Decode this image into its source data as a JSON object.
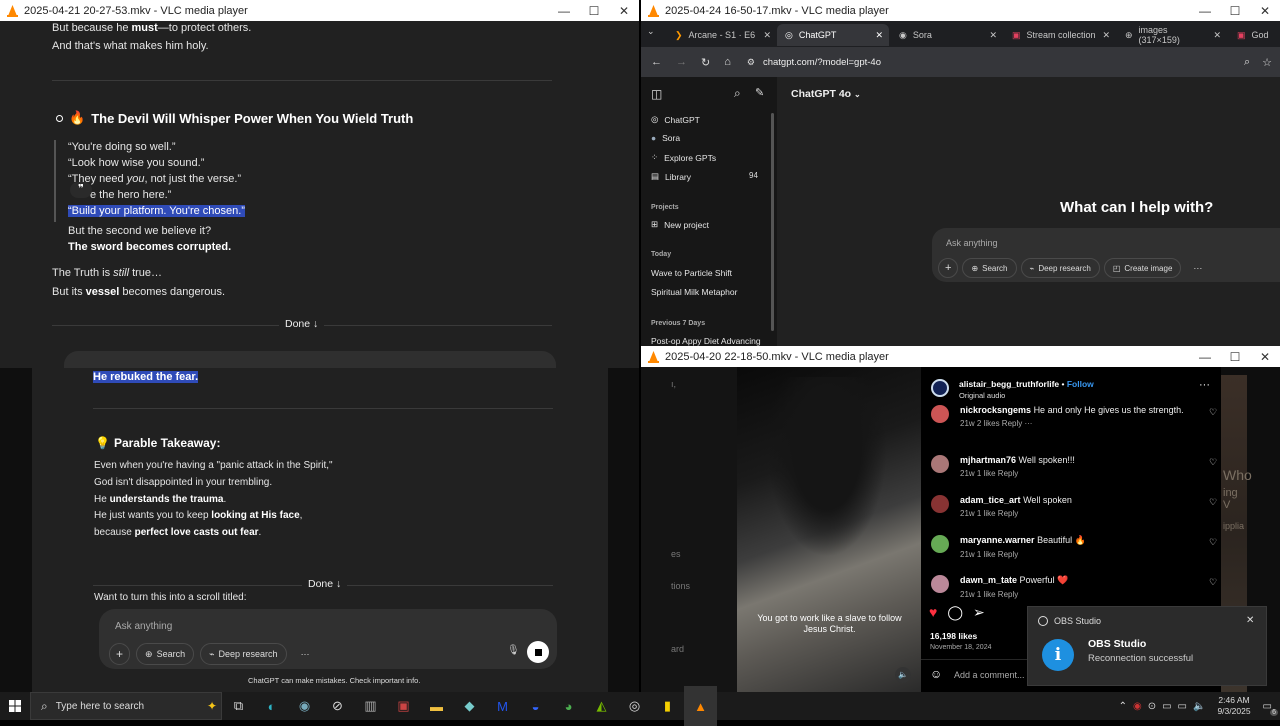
{
  "vlc1": {
    "title": "2025-04-21 20-27-53.mkv - VLC media player"
  },
  "vlc2": {
    "title": "2025-04-24 16-50-17.mkv - VLC media player"
  },
  "vlc3": {
    "title": "2025-04-20 22-18-50.mkv - VLC media player"
  },
  "chat1": {
    "line1a": "But because he ",
    "line1b": "must",
    "line1c": "—to protect others.",
    "line2": "And that's what makes him holy.",
    "heading": "The Devil Will Whisper Power When You Wield Truth",
    "q1": "“You're doing so well.”",
    "q2": "“Look how wise you sound.”",
    "q3a": "“They need ",
    "q3b": "you",
    "q3c": ", not just the verse.”",
    "q4": "e the hero here.”",
    "q5": "“Build your platform. You're chosen.”",
    "p1": "But the second we believe it?",
    "p2": "The sword becomes corrupted.",
    "t1a": "The Truth is ",
    "t1b": "still",
    "t1c": " true…",
    "t2a": "But its ",
    "t2b": "vessel",
    "t2c": " becomes dangerous.",
    "done": "Done",
    "ask": "Ask anything"
  },
  "chat2": {
    "hl": "He rebuked the fear.",
    "heading": "Parable Takeaway:",
    "l1": "Even when you're having a \"panic attack in the Spirit,\"",
    "l2": "God isn't disappointed in your trembling.",
    "l3a": "He ",
    "l3b": "understands the trauma",
    "l4a": "He just wants you to keep ",
    "l4b": "looking at His face",
    "l5a": "because ",
    "l5b": "perfect love casts out fear",
    "done": "Done",
    "scroll": "Want to turn this into a scroll titled:",
    "ask": "Ask anything",
    "search": "Search",
    "deep": "Deep research",
    "disclaimer": "ChatGPT can make mistakes. Check important info."
  },
  "browser": {
    "tabs": [
      "Arcane - S1 · E6",
      "ChatGPT",
      "Sora",
      "Stream collection",
      "images (317×159)",
      "God"
    ],
    "url": "chatgpt.com/?model=gpt-4o",
    "model": "ChatGPT 4o",
    "side": [
      "ChatGPT",
      "Sora",
      "Explore GPTs",
      "Library"
    ],
    "library_count": "94",
    "projects": "Projects",
    "new_project": "New project",
    "today": "Today",
    "today_items": [
      "Wave to Particle Shift",
      "Spiritual Milk Metaphor"
    ],
    "prev": "Previous 7 Days",
    "prev_items": [
      "Post-op Appy Diet Advancing"
    ],
    "hero": "What can I help with?",
    "ask": "Ask anything",
    "search": "Search",
    "deep": "Deep research",
    "create": "Create image"
  },
  "insta": {
    "user": "alistair_begg_truthforlife",
    "follow": "Follow",
    "audio": "Original audio",
    "comments": [
      {
        "u": "nickrocksngems",
        "t": "He and only He gives us the strength.",
        "m": "21w   2 likes   Reply   ···",
        "c": "#c55"
      },
      {
        "u": "mjhartman76",
        "t": "Well spoken!!!",
        "m": "21w   1 like   Reply",
        "c": "#a77"
      },
      {
        "u": "adam_tice_art",
        "t": "Well spoken",
        "m": "21w   1 like   Reply",
        "c": "#833"
      },
      {
        "u": "maryanne.warner",
        "t": "Beautiful 🔥",
        "m": "21w   1 like   Reply",
        "c": "#6a5"
      },
      {
        "u": "dawn_m_tate",
        "t": "Powerful ❤️",
        "m": "21w   1 like   Reply",
        "c": "#b89"
      }
    ],
    "likes": "16,198 likes",
    "date": "November 18, 2024",
    "add": "Add a comment...",
    "subtitle": "You got to work like a slave to follow Jesus Christ.",
    "side_text": [
      "ı,",
      "es",
      "tions",
      "ard"
    ],
    "right_text": [
      "Who",
      "ing V",
      "ipplia"
    ]
  },
  "obs": {
    "app": "OBS Studio",
    "title": "OBS Studio",
    "msg": "Reconnection successful"
  },
  "taskbar": {
    "search": "Type here to search",
    "time": "2:46 AM",
    "date": "9/3/2025",
    "badge": "6"
  }
}
